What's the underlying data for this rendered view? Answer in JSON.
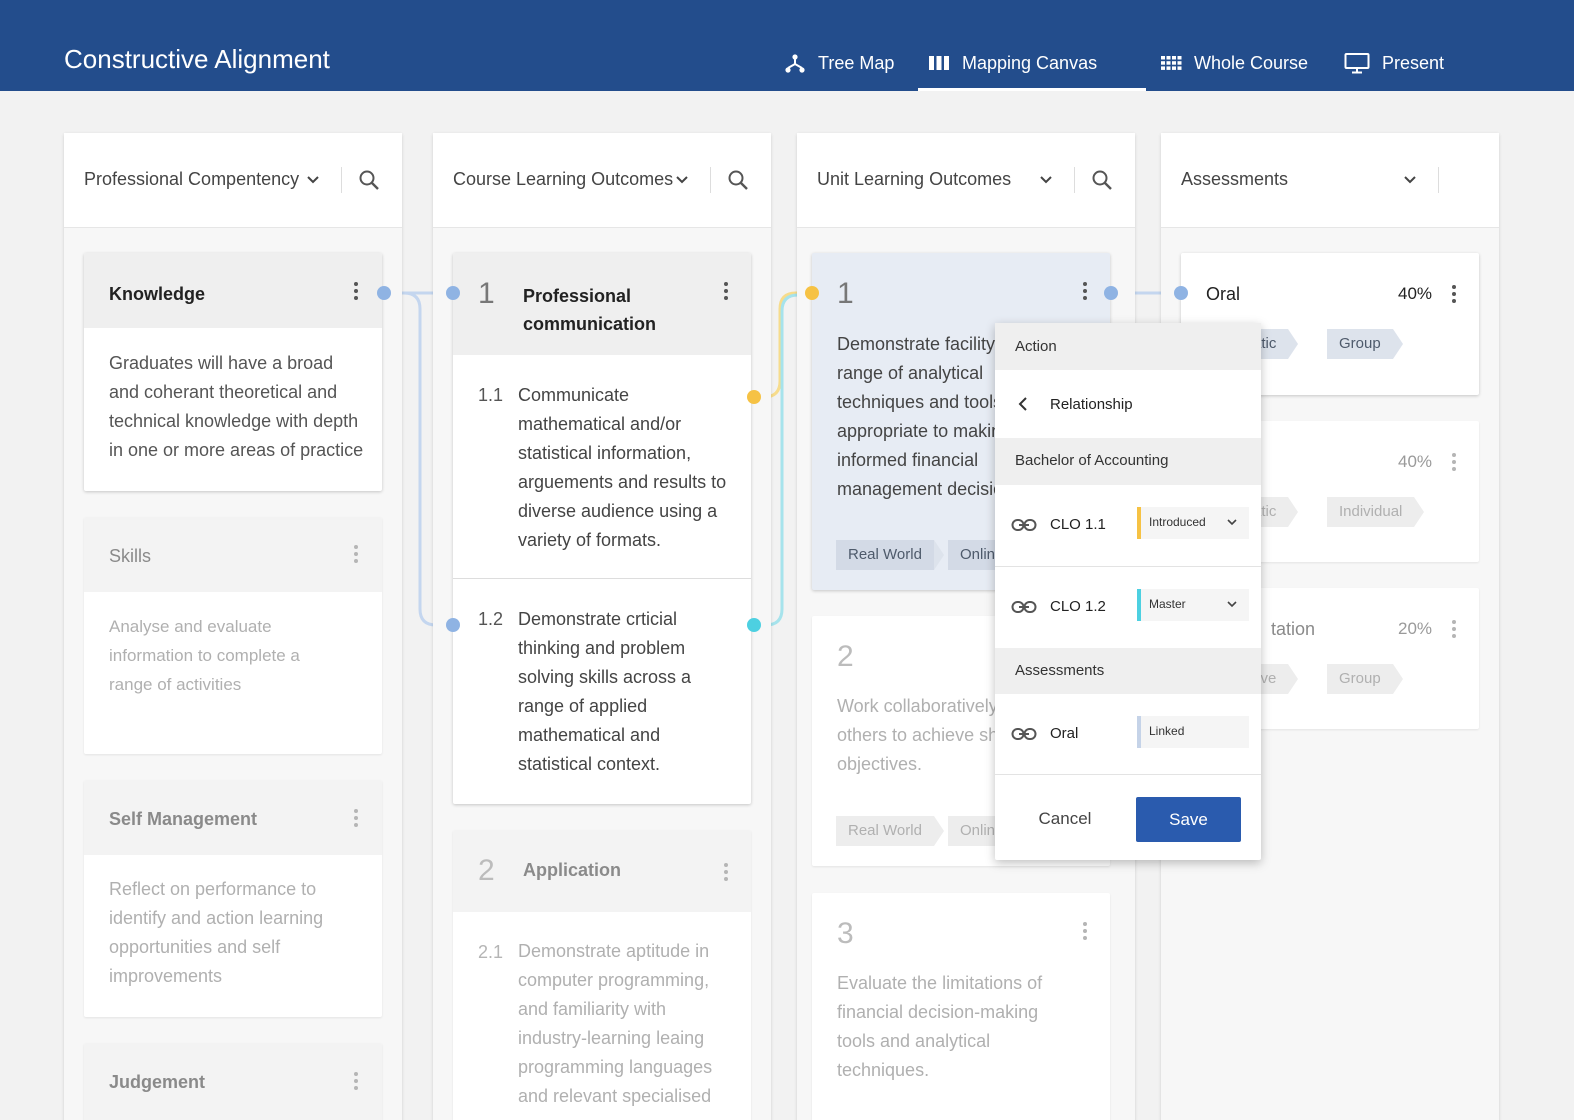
{
  "app": {
    "title": "Constructive Alignment"
  },
  "nav": [
    {
      "label": "Tree Map",
      "icon": "tree-map-icon"
    },
    {
      "label": "Mapping Canvas",
      "icon": "columns-icon",
      "active": true
    },
    {
      "label": "Whole Course",
      "icon": "grid-icon"
    },
    {
      "label": "Present",
      "icon": "monitor-icon"
    }
  ],
  "columns": [
    {
      "title": "Professional Compentency"
    },
    {
      "title": "Course Learning Outcomes"
    },
    {
      "title": "Unit Learning Outcomes"
    },
    {
      "title": "Assessments"
    }
  ],
  "competencies": [
    {
      "title": "Knowledge",
      "text": [
        "Graduates will have a broad",
        "and coherant theoretical and",
        "technical knowledge with depth",
        "in one or more areas of practice"
      ]
    },
    {
      "title": "Skills",
      "text": [
        "Analyse and evaluate",
        "information to complete a",
        "range of activities"
      ]
    },
    {
      "title": "Self Management",
      "text": [
        "Reflect on performance to",
        "identify and action learning",
        "opportunities and self",
        "improvements"
      ]
    },
    {
      "title": "Judgement"
    }
  ],
  "clos": [
    {
      "number": "1",
      "title": [
        "Professional",
        "communication"
      ],
      "items": [
        {
          "number": "1.1",
          "text": [
            "Communicate",
            "mathematical and/or",
            "statistical information,",
            "arguements and results to",
            "diverse audience using a",
            "variety of formats."
          ]
        },
        {
          "number": "1.2",
          "text": [
            "Demonstrate crticial",
            "thinking and problem",
            "solving skills across a",
            "range of applied",
            "mathematical and",
            "statistical context."
          ]
        }
      ]
    },
    {
      "number": "2",
      "title": [
        "Application"
      ],
      "items": [
        {
          "number": "2.1",
          "text": [
            "Demonstrate aptitude in",
            "computer programming,",
            "and familiarity with",
            "industry-learning leaing",
            "programming languages",
            "and relevant specialised"
          ]
        }
      ]
    }
  ],
  "ulos": [
    {
      "number": "1",
      "text": [
        "Demonstrate facility",
        "range of analytical",
        "techniques and tools",
        "appropriate to makin",
        "informed financial",
        "management decisio"
      ],
      "tags": [
        "Real World",
        "Online"
      ]
    },
    {
      "number": "2",
      "text": [
        "Work collaboratively",
        "others to achieve sh",
        "objectives."
      ],
      "tags": [
        "Real World",
        "Online"
      ]
    },
    {
      "number": "3",
      "text": [
        "Evaluate the limitations of",
        "financial decision-making",
        "tools and analytical",
        "techniques."
      ]
    }
  ],
  "assessments": [
    {
      "title": "Oral",
      "percent": "40%",
      "tags": [
        "atic",
        "Group"
      ]
    },
    {
      "title": "",
      "percent": "40%",
      "tags": [
        "atic",
        "Individual"
      ]
    },
    {
      "title": "tation",
      "percent": "20%",
      "tags": [
        "tive",
        "Group"
      ]
    }
  ],
  "popup": {
    "header": "Action",
    "back_label": "Relationship",
    "section1": "Bachelor of Accounting",
    "links": [
      {
        "label": "CLO 1.1",
        "value": "Introduced",
        "color": "#f6c244"
      },
      {
        "label": "CLO 1.2",
        "value": "Master",
        "color": "#4dd0e1"
      }
    ],
    "section2": "Assessments",
    "assessment_link": {
      "label": "Oral",
      "value": "Linked",
      "color": "#c5d3e8"
    },
    "cancel": "Cancel",
    "save": "Save"
  },
  "colors": {
    "header": "#234d8c",
    "primary": "#2a5bae",
    "connector_blue": "#8fb3e3",
    "connector_yellow": "#f6c244",
    "connector_cyan": "#4dd0e1"
  }
}
